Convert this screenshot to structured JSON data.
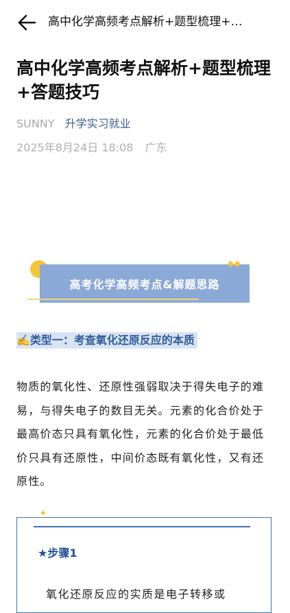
{
  "nav": {
    "title": "高中化学高频考点解析+题型梳理+…"
  },
  "article": {
    "title": "高中化学高频考点解析+题型梳理+答题技巧",
    "author": "SUNNY",
    "account": "升学实习就业",
    "date": "2025年8月24日 18:08",
    "location": "广东"
  },
  "banner": {
    "text": "高考化学高频考点&解题思路",
    "colors": {
      "box": "#8ba9d6",
      "accent": "#f5c535"
    }
  },
  "section": {
    "heading": "✍️类型一：考查氧化还原反应的本质",
    "paragraph": "物质的氧化性、还原性强弱取决于得失电子的难易，与得失电子的数目无关。元素的化合价处于最高价态只具有氧化性，元素的化合价处于最低价只具有还原性，中间价态既有氧化性，又有还原性。"
  },
  "step": {
    "title": "★步骤1",
    "text": "氧化还原反应的实质是电子转移或"
  }
}
